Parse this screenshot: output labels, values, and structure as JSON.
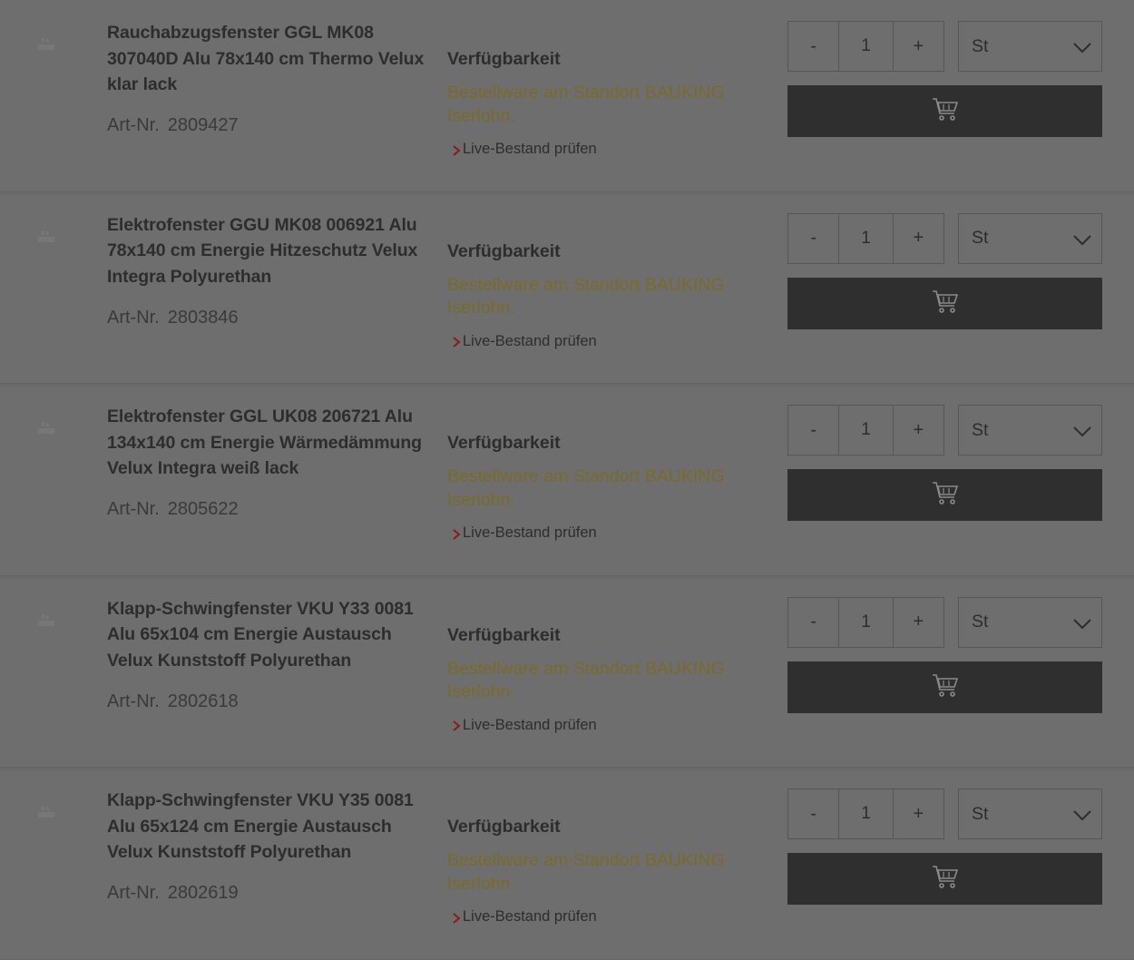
{
  "products": [
    {
      "title": "Rauchabzugsfenster GGL MK08 307040D Alu 78x140 cm Thermo Velux klar lack",
      "artnr_label": "Art-Nr.",
      "artnr": "2809427",
      "availability_label": "Verfügbarkeit",
      "availability_text": "Bestellware am Standort BAUKING Iserlohn.",
      "live_link": "Live-Bestand prüfen",
      "qty_minus": "-",
      "qty": "1",
      "qty_plus": "+",
      "unit": "St"
    },
    {
      "title": "Elektrofenster GGU MK08 006921 Alu 78x140 cm Energie Hitzeschutz Velux Integra Polyurethan",
      "artnr_label": "Art-Nr.",
      "artnr": "2803846",
      "availability_label": "Verfügbarkeit",
      "availability_text": "Bestellware am Standort BAUKING Iserlohn.",
      "live_link": "Live-Bestand prüfen",
      "qty_minus": "-",
      "qty": "1",
      "qty_plus": "+",
      "unit": "St"
    },
    {
      "title": "Elektrofenster GGL UK08 206721 Alu 134x140 cm Energie Wärmedämmung Velux Integra weiß lack",
      "artnr_label": "Art-Nr.",
      "artnr": "2805622",
      "availability_label": "Verfügbarkeit",
      "availability_text": "Bestellware am Standort BAUKING Iserlohn.",
      "live_link": "Live-Bestand prüfen",
      "qty_minus": "-",
      "qty": "1",
      "qty_plus": "+",
      "unit": "St"
    },
    {
      "title": "Klapp-Schwingfenster VKU Y33 0081 Alu 65x104 cm Energie Austausch Velux Kunststoff Polyurethan",
      "artnr_label": "Art-Nr.",
      "artnr": "2802618",
      "availability_label": "Verfügbarkeit",
      "availability_text": "Bestellware am Standort BAUKING Iserlohn.",
      "live_link": "Live-Bestand prüfen",
      "qty_minus": "-",
      "qty": "1",
      "qty_plus": "+",
      "unit": "St"
    },
    {
      "title": "Klapp-Schwingfenster VKU Y35 0081 Alu 65x124 cm Energie Austausch Velux Kunststoff Polyurethan",
      "artnr_label": "Art-Nr.",
      "artnr": "2802619",
      "availability_label": "Verfügbarkeit",
      "availability_text": "Bestellware am Standort BAUKING Iserlohn.",
      "live_link": "Live-Bestand prüfen",
      "qty_minus": "-",
      "qty": "1",
      "qty_plus": "+",
      "unit": "St"
    }
  ],
  "icons": {
    "thumbnail": "image-placeholder-icon",
    "link_chevron": "chevron-right-icon",
    "dropdown": "chevron-down-icon",
    "cart": "shopping-cart-icon"
  },
  "colors": {
    "overlay_background": "#6e6e6e",
    "availability_text": "#7a6a2a",
    "link_chevron": "#8b1a1a",
    "cart_button": "#2f2f2f"
  }
}
